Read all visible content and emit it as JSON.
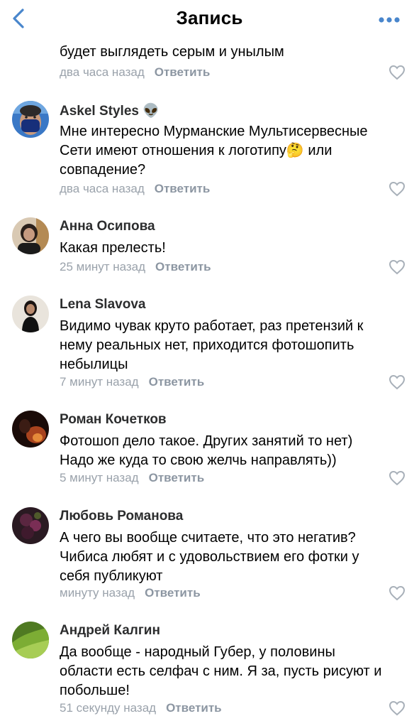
{
  "header": {
    "title": "Запись",
    "back_icon": "chevron-left-icon",
    "more_icon": "more-horizontal-icon",
    "accent": "#4986cc"
  },
  "partial": {
    "text": "будет выглядеть серым и унылым",
    "time": "два часа назад",
    "reply": "Ответить"
  },
  "comments": [
    {
      "author": "Askel Styles",
      "emoji": "👽",
      "lines": [
        "Мне интересно Мурманские Мультисервесные",
        "Сети имеют отношения к логотипу🤔 или",
        "совпадение?"
      ],
      "time": "два часа назад",
      "reply": "Ответить"
    },
    {
      "author": "Анна Осипова",
      "lines": [
        "Какая прелесть!"
      ],
      "time": "25 минут назад",
      "reply": "Ответить"
    },
    {
      "author": "Lena Slavova",
      "lines": [
        "Видимо чувак круто работает, раз претензий к",
        "нему реальных нет, приходится фотошопить",
        "небылицы"
      ],
      "time": "7 минут назад",
      "reply": "Ответить"
    },
    {
      "author": "Роман Кочетков",
      "lines": [
        "Фотошоп дело такое. Других занятий то нет)",
        "Надо же куда то свою желчь направлять))"
      ],
      "time": "5 минут назад",
      "reply": "Ответить"
    },
    {
      "author": "Любовь Романова",
      "lines": [
        "А чего вы вообще считаете, что это негатив?",
        "Чибиса любят и с удовольствием его фотки у",
        "себя публикуют"
      ],
      "time": "минуту назад",
      "reply": "Ответить"
    },
    {
      "author": "Андрей Калгин",
      "lines": [
        "Да вообще - народный Губер, у половины",
        "области есть селфач с ним. Я за, пусть рисуют и",
        "побольше!"
      ],
      "time": "51 секунду назад",
      "reply": "Ответить"
    }
  ]
}
